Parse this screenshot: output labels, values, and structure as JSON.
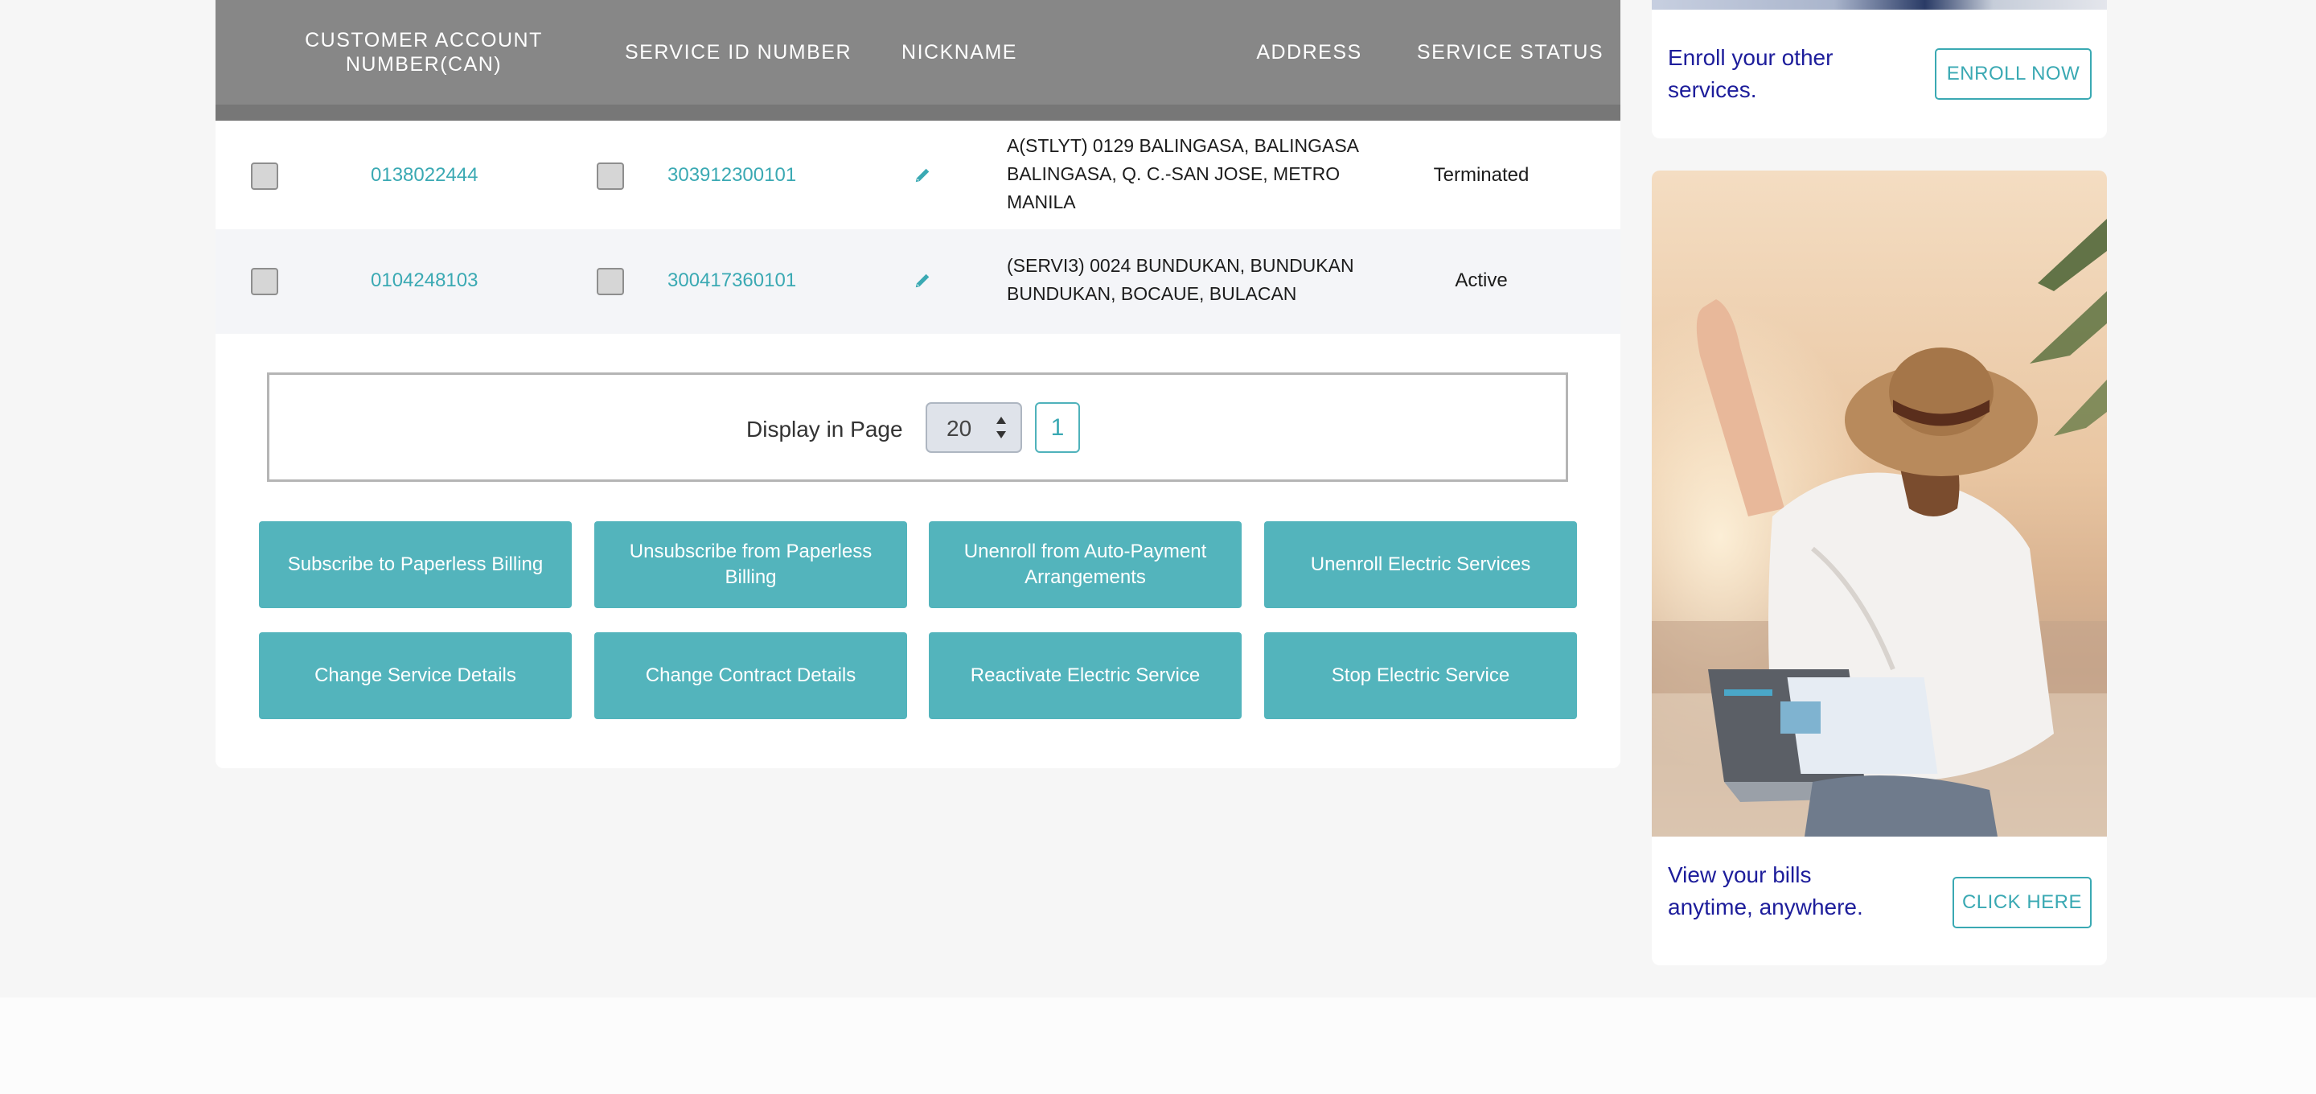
{
  "table": {
    "headers": {
      "can": "CUSTOMER ACCOUNT NUMBER(CAN)",
      "sin": "SERVICE ID NUMBER",
      "nickname": "NICKNAME",
      "address": "ADDRESS",
      "status": "SERVICE STATUS"
    },
    "rows": [
      {
        "can": "0138022444",
        "sin": "303912300101",
        "address": "A(STLYT) 0129 BALINGASA, BALINGASA BALINGASA, Q. C.-SAN JOSE, METRO MANILA",
        "status": "Terminated"
      },
      {
        "can": "0104248103",
        "sin": "300417360101",
        "address": "(SERVI3) 0024 BUNDUKAN, BUNDUKAN BUNDUKAN, BOCAUE, BULACAN",
        "status": "Active"
      }
    ]
  },
  "pager": {
    "label": "Display in Page",
    "page_size": "20",
    "current_page": "1"
  },
  "actions": {
    "subscribe_paperless": "Subscribe to Paperless Billing",
    "unsubscribe_paperless": "Unsubscribe from Paperless Billing",
    "unenroll_autopay": "Unenroll from Auto-Payment Arrangements",
    "unenroll_electric": "Unenroll Electric Services",
    "change_service": "Change Service Details",
    "change_contract": "Change Contract Details",
    "reactivate": "Reactivate Electric Service",
    "stop": "Stop Electric Service"
  },
  "sidebar": {
    "enroll": {
      "text_line1": "Enroll your other",
      "text_line2": "services.",
      "button": "ENROLL NOW"
    },
    "bills": {
      "text_line1": "View your bills",
      "text_line2": "anytime, anywhere.",
      "button": "CLICK HERE"
    }
  },
  "colors": {
    "accent": "#53b4bc",
    "link": "#3aa9b3",
    "header_bg": "#878787",
    "promo_text": "#1d1d9b"
  },
  "icons": [
    "pencil-icon",
    "checkbox",
    "stepper-arrows"
  ]
}
